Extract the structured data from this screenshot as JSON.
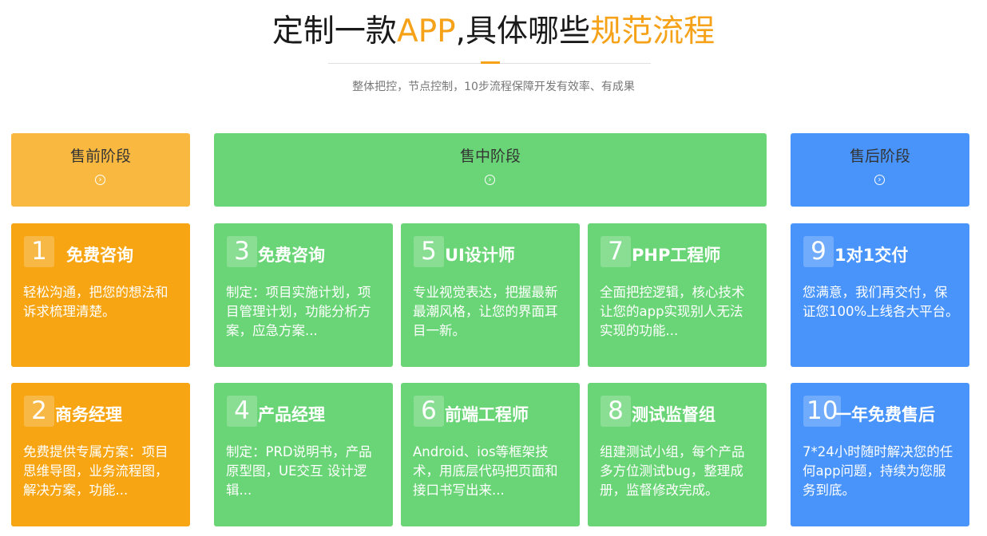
{
  "header": {
    "title_part1": "定制一款",
    "title_highlight1": "APP",
    "title_part2": ",具体哪些",
    "title_highlight2": "规范流程",
    "subtitle": "整体把控，节点控制，10步流程保障开发有效率、有成果"
  },
  "colors": {
    "accent": "#f5a219",
    "orange": "#f7a512",
    "green": "#6ad576",
    "blue": "#4894fb"
  },
  "stages": [
    {
      "label": "售前阶段",
      "icon": "chevron-right-circle-icon"
    },
    {
      "label": "售中阶段",
      "icon": "chevron-right-circle-icon"
    },
    {
      "label": "售后阶段",
      "icon": "chevron-right-circle-icon"
    }
  ],
  "cards": [
    {
      "num": "1",
      "title": "免费咨询",
      "desc": "轻松沟通，把您的想法和诉求梳理清楚。"
    },
    {
      "num": "2",
      "title": "商务经理",
      "desc": "免费提供专属方案：项目思维导图，业务流程图，解决方案，功能..."
    },
    {
      "num": "3",
      "title": "免费咨询",
      "desc": "制定：项目实施计划，项目管理计划，功能分析方案，应急方案..."
    },
    {
      "num": "4",
      "title": "产品经理",
      "desc": "制定：PRD说明书，产品原型图，UE交互 设计逻辑..."
    },
    {
      "num": "5",
      "title": "UI设计师",
      "desc": "专业视觉表达，把握最新最潮风格，让您的界面耳目一新。"
    },
    {
      "num": "6",
      "title": "前端工程师",
      "desc": "Android、ios等框架技术，用底层代码把页面和接口书写出来..."
    },
    {
      "num": "7",
      "title": "PHP工程师",
      "desc": "全面把控逻辑，核心技术让您的app实现别人无法实现的功能..."
    },
    {
      "num": "8",
      "title": "测试监督组",
      "desc": "组建测试小组，每个产品多方位测试bug，整理成册，监督修改完成。"
    },
    {
      "num": "9",
      "title": "1对1交付",
      "desc": "您满意，我们再交付，保证您100%上线各大平台。"
    },
    {
      "num": "10",
      "title": "一年免费售后",
      "desc": "7*24小时随时解决您的任何app问题，持续为您服务到底。"
    }
  ]
}
